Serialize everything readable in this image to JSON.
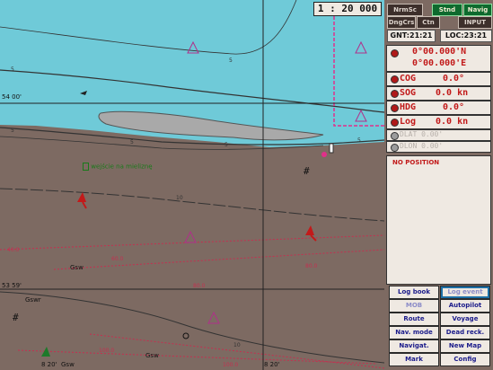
{
  "map": {
    "scale": "1 : 20 000",
    "lat_labels": [
      "54 00'",
      "53 59'"
    ],
    "lon_labels": [
      "8 20'",
      "8 20'"
    ],
    "depth_labels": [
      "5",
      "5",
      "5",
      "5",
      "5",
      "5",
      "10",
      "10",
      "40.0",
      "60.0",
      "80.0",
      "100.0",
      "80.0",
      "100.0"
    ],
    "note": "wejście na mieliznę",
    "buoy_labels": [
      "Gsw",
      "Gswr",
      "Gsw",
      "Gsw"
    ],
    "colors": {
      "shallow": "#6fcad8",
      "land": "#a9a9a9",
      "sea": "#ffffff",
      "accent": "#e0308a",
      "grid": "#222222"
    }
  },
  "panel": {
    "top_buttons": [
      "NrmSc",
      "Stnd",
      "Navig"
    ],
    "row2": [
      "DngCrs",
      "Ctn",
      "INPUT"
    ],
    "gnt": "GNT:21:21",
    "loc": "LOC:23:21",
    "position": [
      "0°00.000'N",
      "0°00.000'E"
    ],
    "cog": {
      "label": "COG",
      "value": "0.0°"
    },
    "sog": {
      "label": "SOG",
      "value": "0.0 kn"
    },
    "hdg": {
      "label": "HDG",
      "value": "0.0°"
    },
    "log": {
      "label": "Log",
      "value": "0.0 kn"
    },
    "dlat": "DLAT 0.00'",
    "dlon": "DLON 0.00'",
    "status": "NO POSITION",
    "buttons": [
      {
        "label": "Log book"
      },
      {
        "label": "Log event"
      },
      {
        "label": "MOB"
      },
      {
        "label": "Autopilot"
      },
      {
        "label": "Route"
      },
      {
        "label": "Voyage"
      },
      {
        "label": "Nav. mode"
      },
      {
        "label": "Dead reck."
      },
      {
        "label": "Navigat."
      },
      {
        "label": "New Map"
      },
      {
        "label": "Mark"
      },
      {
        "label": "Config"
      }
    ]
  }
}
